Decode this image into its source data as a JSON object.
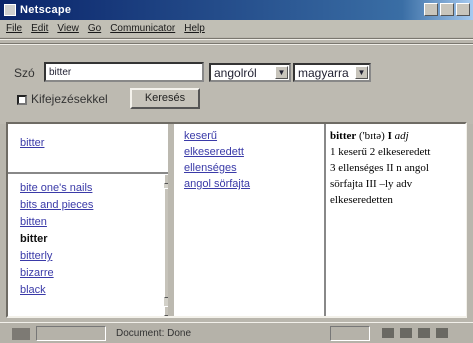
{
  "window": {
    "title": "Netscape"
  },
  "menu": [
    {
      "label": "File"
    },
    {
      "label": "Edit"
    },
    {
      "label": "View"
    },
    {
      "label": "Go"
    },
    {
      "label": "Communicator"
    },
    {
      "label": "Help"
    }
  ],
  "form": {
    "word_label": "Szó",
    "word_value": "bitter",
    "source_lang": "angolról",
    "target_lang": "magyarra",
    "phrases_label": "Kifejezésekkel",
    "search_button": "Keresés"
  },
  "left_top": {
    "link": "bitter"
  },
  "word_list": [
    {
      "label": "bite one's nails",
      "current": false
    },
    {
      "label": "bits and pieces",
      "current": false
    },
    {
      "label": "bitten",
      "current": false
    },
    {
      "label": "bitter",
      "current": true
    },
    {
      "label": "bitterly",
      "current": false
    },
    {
      "label": "bizarre",
      "current": false
    },
    {
      "label": "black",
      "current": false
    }
  ],
  "translations": [
    {
      "label": "keserű"
    },
    {
      "label": "elkeseredett"
    },
    {
      "label": "ellenséges"
    },
    {
      "label": "angol sörfajta"
    }
  ],
  "entry": {
    "headword": "bitter",
    "pron": "('bɪtə)",
    "pos_num": "I",
    "pos": "adj",
    "line1": "1 keserű 2 elkeseredett",
    "line2": "3 ellenséges II n angol",
    "line3": "sörfajta III –ly adv",
    "line4": "elkeseredetten"
  },
  "status": {
    "text": "Document: Done"
  }
}
